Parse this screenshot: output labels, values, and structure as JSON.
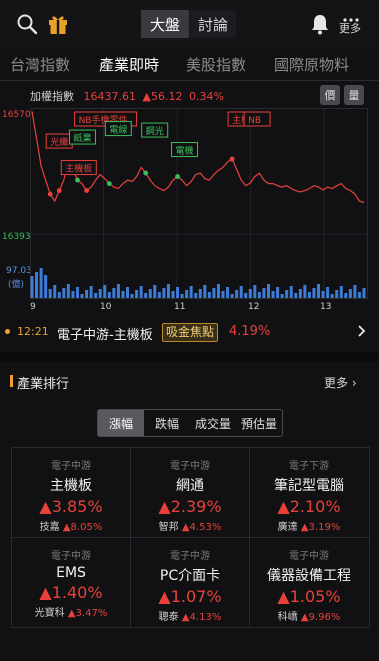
{
  "header": {
    "segments": [
      "大盤",
      "討論"
    ],
    "more_label": "更多"
  },
  "tabs": [
    "台灣指數",
    "產業即時",
    "美股指數",
    "國際原物料"
  ],
  "index_line": {
    "name": "加權指數",
    "value": "16437.61",
    "change": "▲56.12",
    "percent": "0.34%",
    "chips": [
      "價",
      "量"
    ]
  },
  "chart_data": {
    "type": "line",
    "y_max_label": "16570",
    "y_min_label": "16393",
    "volume_label": "97.03",
    "volume_unit": "(億)",
    "x_ticks": [
      "9",
      "10",
      "11",
      "12",
      "13"
    ],
    "ylim": [
      16393,
      16570
    ],
    "series": [
      {
        "values": [
          16568,
          16530,
          16490,
          16470,
          16450,
          16440,
          16455,
          16470,
          16495,
          16488,
          16470,
          16465,
          16455,
          16460,
          16470,
          16478,
          16472,
          16465,
          16460,
          16458,
          16465,
          16470,
          16468,
          16475,
          16488,
          16480,
          16470,
          16462,
          16458,
          16455,
          16460,
          16470,
          16475,
          16470,
          16462,
          16468,
          16478,
          16480,
          16472,
          16470,
          16478,
          16484,
          16488,
          16496,
          16500,
          16485,
          16470,
          16462,
          16466,
          16475,
          16480,
          16470,
          16465,
          16465,
          16462,
          16460,
          16462,
          16458,
          16455,
          16453,
          16455,
          16458,
          16462,
          16460,
          16456,
          16460,
          16458,
          16462,
          16465,
          16458,
          16455,
          16450,
          16440,
          16438
        ]
      }
    ],
    "annotations": [
      {
        "label": "光纖",
        "color": "red"
      },
      {
        "label": "主機板",
        "color": "red"
      },
      {
        "label": "NB手機零件",
        "color": "red"
      },
      {
        "label": "紙業",
        "color": "green"
      },
      {
        "label": "電線",
        "color": "green"
      },
      {
        "label": "鋼光",
        "color": "green"
      },
      {
        "label": "電機",
        "color": "green"
      },
      {
        "label": "主機板",
        "color": "red"
      },
      {
        "label": "NB",
        "color": "red"
      }
    ]
  },
  "ticker": {
    "time": "12:21",
    "text": "電子中游-主機板",
    "badge": "吸金焦點",
    "percent": "4.19%"
  },
  "section": {
    "title": "產業排行",
    "more": "更多"
  },
  "filters": [
    "漲幅",
    "跌幅",
    "成交量",
    "預估量"
  ],
  "industries": [
    {
      "category": "電子中游",
      "name": "主機板",
      "pct": "▲3.85%",
      "stock": "技嘉",
      "stock_pct": "▲8.05%"
    },
    {
      "category": "電子中游",
      "name": "網通",
      "pct": "▲2.39%",
      "stock": "智邦",
      "stock_pct": "▲4.53%"
    },
    {
      "category": "電子下游",
      "name": "筆記型電腦",
      "pct": "▲2.10%",
      "stock": "廣達",
      "stock_pct": "▲3.19%"
    },
    {
      "category": "電子中游",
      "name": "EMS",
      "pct": "▲1.40%",
      "stock": "光寶科",
      "stock_pct": "▲3.47%"
    },
    {
      "category": "電子中游",
      "name": "PC介面卡",
      "pct": "▲1.07%",
      "stock": "聰泰",
      "stock_pct": "▲4.13%"
    },
    {
      "category": "電子中游",
      "name": "儀器設備工程",
      "pct": "▲1.05%",
      "stock": "科嶠",
      "stock_pct": "▲9.96%"
    }
  ],
  "colors": {
    "up": "#e8413a",
    "line": "#e8413a",
    "volume": "#3d7dd8",
    "accent": "#f0a030"
  }
}
